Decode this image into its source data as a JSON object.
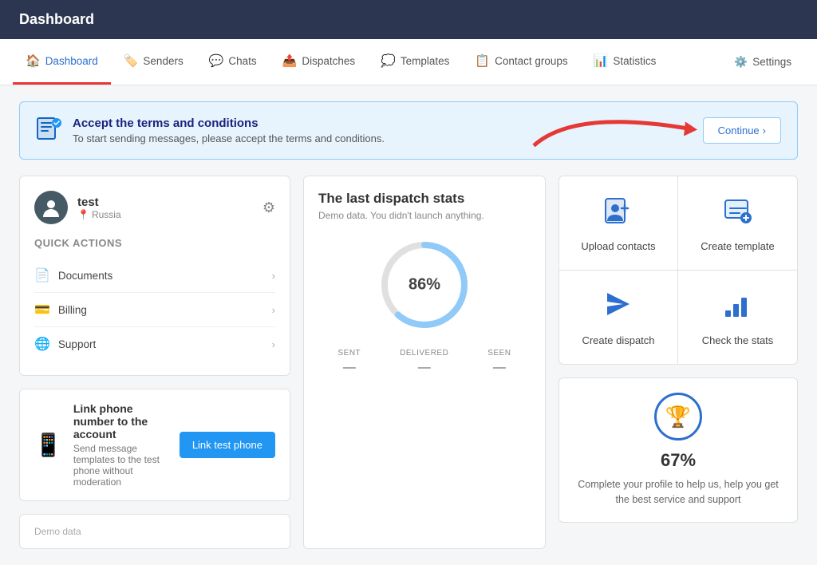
{
  "topbar": {
    "title": "Dashboard"
  },
  "nav": {
    "items": [
      {
        "id": "dashboard",
        "label": "Dashboard",
        "icon": "🏠",
        "active": true
      },
      {
        "id": "senders",
        "label": "Senders",
        "icon": "🏷️",
        "active": false
      },
      {
        "id": "chats",
        "label": "Chats",
        "icon": "💬",
        "active": false
      },
      {
        "id": "dispatches",
        "label": "Dispatches",
        "icon": "📤",
        "active": false
      },
      {
        "id": "templates",
        "label": "Templates",
        "icon": "💭",
        "active": false
      },
      {
        "id": "contact-groups",
        "label": "Contact groups",
        "icon": "📋",
        "active": false
      },
      {
        "id": "statistics",
        "label": "Statistics",
        "icon": "📊",
        "active": false
      }
    ],
    "settings_label": "Settings"
  },
  "alert": {
    "title": "Accept the terms and conditions",
    "description": "To start sending messages, please accept the terms and conditions.",
    "button_label": "Continue",
    "button_icon": "›"
  },
  "user": {
    "name": "test",
    "location": "Russia",
    "quick_actions_label": "Quick actions",
    "actions": [
      {
        "id": "documents",
        "label": "Documents",
        "icon": "📄"
      },
      {
        "id": "billing",
        "label": "Billing",
        "icon": "💳"
      },
      {
        "id": "support",
        "label": "Support",
        "icon": "🌐"
      }
    ]
  },
  "link_phone": {
    "title": "Link phone number to the account",
    "description": "Send message templates to the test phone without moderation",
    "button_label": "Link test phone"
  },
  "dispatch_stats": {
    "title": "The last dispatch stats",
    "subtitle": "Demo data. You didn't launch anything.",
    "percentage": "86%",
    "stats": [
      {
        "label": "SENT",
        "value": "—"
      },
      {
        "label": "DELIVERED",
        "value": "—"
      },
      {
        "label": "SEEN",
        "value": "—"
      }
    ]
  },
  "quick_action_grid": {
    "items": [
      {
        "id": "upload-contacts",
        "label": "Upload contacts",
        "icon": "👤"
      },
      {
        "id": "create-template",
        "label": "Create template",
        "icon": "💬"
      },
      {
        "id": "create-dispatch",
        "label": "Create dispatch",
        "icon": "📨"
      },
      {
        "id": "check-stats",
        "label": "Check the stats",
        "icon": "📊"
      }
    ]
  },
  "profile_completion": {
    "percentage": "67%",
    "description": "Complete your profile to help us, help you get the best service and support"
  },
  "demo_bar": {
    "label": "Demo data"
  }
}
